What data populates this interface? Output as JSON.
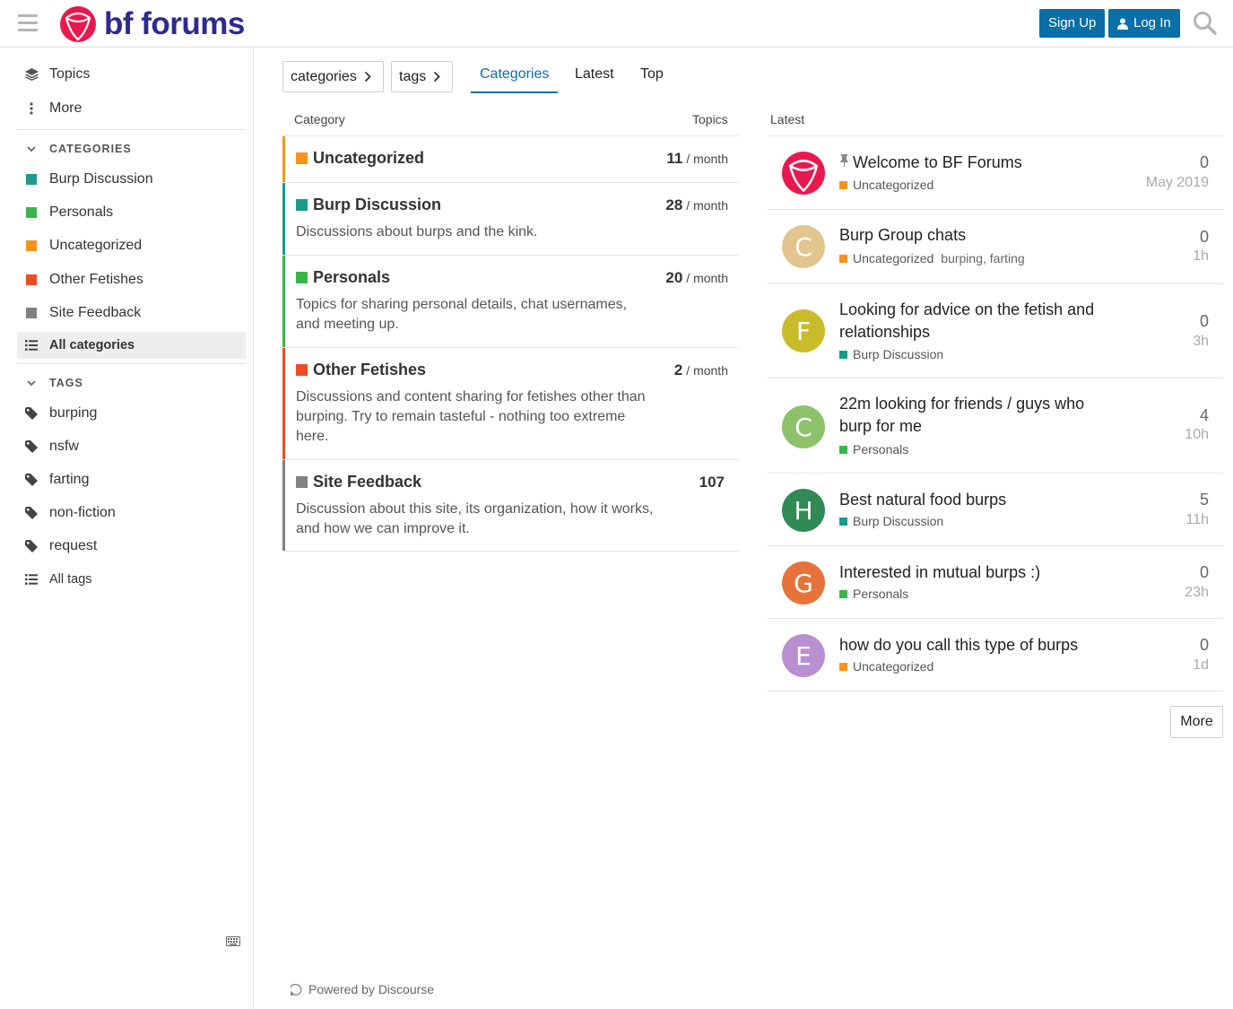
{
  "header": {
    "site_name": "bf forums",
    "signup_label": "Sign Up",
    "login_label": "Log In",
    "brand_color": "#e8194f",
    "button_color": "#0a6ea8"
  },
  "sidebar": {
    "nav": [
      {
        "label": "Topics",
        "icon": "layers-icon"
      },
      {
        "label": "More",
        "icon": "vertical-ellipsis-icon"
      }
    ],
    "categories_heading": "CATEGORIES",
    "categories": [
      {
        "label": "Burp Discussion",
        "color": "#1e9a8a"
      },
      {
        "label": "Personals",
        "color": "#3ab54a"
      },
      {
        "label": "Uncategorized",
        "color": "#f7941d"
      },
      {
        "label": "Other Fetishes",
        "color": "#ee4c26"
      },
      {
        "label": "Site Feedback",
        "color": "#808281"
      }
    ],
    "all_categories_label": "All categories",
    "tags_heading": "TAGS",
    "tags": [
      "burping",
      "nsfw",
      "farting",
      "non-fiction",
      "request"
    ],
    "all_tags_label": "All tags"
  },
  "filters": {
    "categories_dropdown": "categories",
    "tags_dropdown": "tags",
    "tabs": [
      "Categories",
      "Latest",
      "Top"
    ],
    "active_tab": "Categories"
  },
  "category_table": {
    "col_category": "Category",
    "col_topics": "Topics",
    "rows": [
      {
        "name": "Uncategorized",
        "color": "#f7941d",
        "count": "11",
        "unit": "/ month",
        "description": ""
      },
      {
        "name": "Burp Discussion",
        "color": "#1e9a8a",
        "count": "28",
        "unit": "/ month",
        "description": "Discussions about burps and the kink."
      },
      {
        "name": "Personals",
        "color": "#3ab54a",
        "count": "20",
        "unit": "/ month",
        "description": "Topics for sharing personal details, chat usernames, and meeting up."
      },
      {
        "name": "Other Fetishes",
        "color": "#ee4c26",
        "count": "2",
        "unit": "/ month",
        "description": "Discussions and content sharing for fetishes other than burping. Try to remain tasteful - nothing too extreme here."
      },
      {
        "name": "Site Feedback",
        "color": "#808281",
        "count": "107",
        "unit": "",
        "description": "Discussion about this site, its organization, how it works, and how we can improve it."
      }
    ]
  },
  "latest": {
    "heading": "Latest",
    "topics": [
      {
        "title": "Welcome to BF Forums",
        "pinned": true,
        "avatar": "",
        "avatar_color": "#e8194f",
        "category": "Uncategorized",
        "category_color": "#f7941d",
        "tags": "",
        "replies": "0",
        "age": "May 2019"
      },
      {
        "title": "Burp Group chats",
        "pinned": false,
        "avatar": "C",
        "avatar_color": "#e3c58f",
        "category": "Uncategorized",
        "category_color": "#f7941d",
        "tags": "burping, farting",
        "replies": "0",
        "age": "1h"
      },
      {
        "title": "Looking for advice on the fetish and relationships",
        "pinned": false,
        "avatar": "F",
        "avatar_color": "#c9bc2a",
        "category": "Burp Discussion",
        "category_color": "#1e9a8a",
        "tags": "",
        "replies": "0",
        "age": "3h"
      },
      {
        "title": "22m looking for friends / guys who burp for me",
        "pinned": false,
        "avatar": "C",
        "avatar_color": "#8ec26a",
        "category": "Personals",
        "category_color": "#3ab54a",
        "tags": "",
        "replies": "4",
        "age": "10h"
      },
      {
        "title": "Best natural food burps",
        "pinned": false,
        "avatar": "H",
        "avatar_color": "#2f8a54",
        "category": "Burp Discussion",
        "category_color": "#1e9a8a",
        "tags": "",
        "replies": "5",
        "age": "11h"
      },
      {
        "title": "Interested in mutual burps :)",
        "pinned": false,
        "avatar": "G",
        "avatar_color": "#e5733a",
        "category": "Personals",
        "category_color": "#3ab54a",
        "tags": "",
        "replies": "0",
        "age": "23h"
      },
      {
        "title": "how do you call this type of burps",
        "pinned": false,
        "avatar": "E",
        "avatar_color": "#b98fcf",
        "category": "Uncategorized",
        "category_color": "#f7941d",
        "tags": "",
        "replies": "0",
        "age": "1d"
      }
    ],
    "more_label": "More"
  },
  "footer": {
    "powered_by": "Powered by Discourse"
  }
}
